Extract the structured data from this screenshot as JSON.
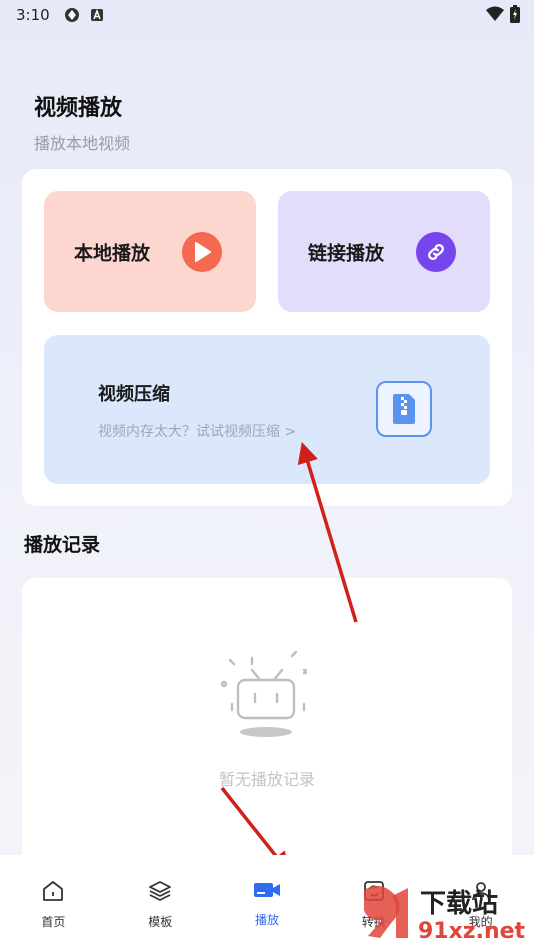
{
  "status_bar": {
    "time": "3:10"
  },
  "page": {
    "title": "视频播放",
    "subtitle": "播放本地视频"
  },
  "tiles": {
    "local": {
      "label": "本地播放",
      "icon": "play-icon"
    },
    "link": {
      "label": "链接播放",
      "icon": "link-icon"
    },
    "compress": {
      "title": "视频压缩",
      "desc": "视频内存太大？试试视频压缩 >",
      "icon": "zip-file-icon"
    }
  },
  "records": {
    "title": "播放记录",
    "empty_text": "暂无播放记录"
  },
  "nav": {
    "items": [
      {
        "label": "首页",
        "icon": "home-icon"
      },
      {
        "label": "模板",
        "icon": "layers-icon"
      },
      {
        "label": "播放",
        "icon": "video-camera-icon",
        "active": true
      },
      {
        "label": "转换",
        "icon": "convert-icon"
      },
      {
        "label": "我的",
        "icon": "profile-icon"
      }
    ]
  },
  "watermark": {
    "text1": "下载站",
    "text2": "91xz.net"
  },
  "colors": {
    "accent": "#2f6cf0",
    "local_tile": "#fdd6d0",
    "link_tile": "#e3dcfb",
    "compress_tile": "#dbe7fb",
    "play_circle": "#f4694f",
    "link_circle": "#7446ec",
    "annotation_arrow": "#d0201c"
  }
}
